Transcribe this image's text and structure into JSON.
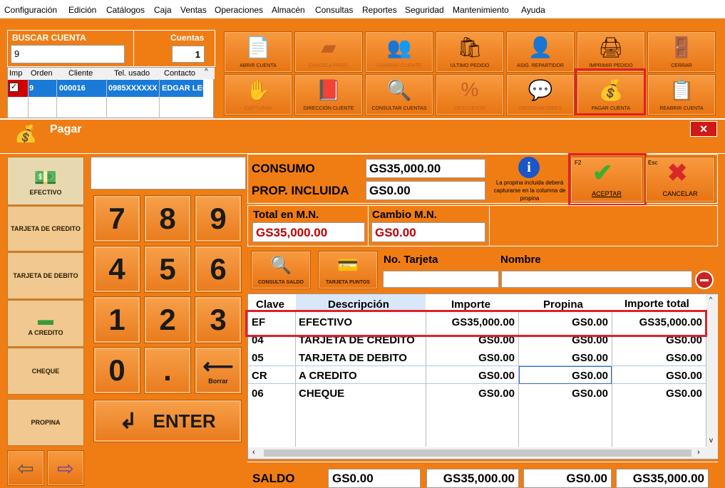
{
  "menu": [
    "Configuración",
    "Edición",
    "Catálogos",
    "Caja",
    "Ventas",
    "Operaciones",
    "Almacén",
    "Consultas",
    "Reportes",
    "Seguridad",
    "Mantenimiento",
    "Ayuda"
  ],
  "search": {
    "label": "BUSCAR CUENTA",
    "value": "9",
    "count_label": "Cuentas",
    "count_value": "1"
  },
  "accounts": {
    "headers": [
      "Imp",
      "Orden",
      "Cliente",
      "Tel. usado",
      "Contacto"
    ],
    "row": {
      "orden": "9",
      "cliente": "000016",
      "tel": "0985XXXXXX",
      "contacto": "EDGAR LEC"
    }
  },
  "toolbar": {
    "abrir": "ABRIR CUENTA",
    "cancela": "CANCELA PROD.",
    "cambiar": "CAMBIAR CLIENTE",
    "ultimo": "ULTIMO PEDIDO",
    "asig": "ASIG. REPARTIDOR",
    "imprimir": "IMPRIMIR PEDIDO",
    "cerrar": "CERRAR",
    "capturar": "CAPTURAR",
    "direccion": "DIRECCIÓN CLIENTE",
    "consultar": "CONSULTAR CUENTAS",
    "descuento": "DESCUENTO",
    "observ": "OBSERVACIONES",
    "pagar": "PAGAR CUENTA",
    "reabrir": "REABRIR CUENTA"
  },
  "dialog": {
    "title": "Pagar",
    "close": "×"
  },
  "methods": {
    "efectivo": "EFECTIVO",
    "tcredito": "TARJETA DE CREDITO",
    "tdebito": "TARJETA DE DEBITO",
    "acredito": "A CREDITO",
    "cheque": "CHEQUE",
    "propina": "PROPINA"
  },
  "keypad": {
    "k7": "7",
    "k8": "8",
    "k9": "9",
    "k4": "4",
    "k5": "5",
    "k6": "6",
    "k1": "1",
    "k2": "2",
    "k3": "3",
    "k0": "0",
    "kdot": ".",
    "borrar": "Borrar",
    "enter": "ENTER"
  },
  "summary": {
    "consumo_label": "CONSUMO",
    "consumo_value": "GS35,000.00",
    "prop_label": "PROP. INCLUIDA",
    "prop_value": "GS0.00",
    "info": "La propina incluida deberá capturarse en la columna de propina",
    "aceptar": "ACEPTAR",
    "aceptar_key": "F2",
    "cancelar": "CANCELAR",
    "cancelar_key": "Esc",
    "total_label": "Total en M.N.",
    "total_value": "GS35,000.00",
    "cambio_label": "Cambio M.N.",
    "cambio_value": "GS0.00"
  },
  "card": {
    "consulta_saldo": "CONSULTA SALDO",
    "tarjeta_puntos": "TARJETA PUNTOS",
    "no_tarjeta": "No. Tarjeta",
    "nombre": "Nombre"
  },
  "payments": {
    "headers": [
      "Clave",
      "Descripción",
      "Importe",
      "Propina",
      "Importe total"
    ],
    "rows": [
      [
        "EF",
        "EFECTIVO",
        "GS35,000.00",
        "GS0.00",
        "GS35,000.00"
      ],
      [
        "04",
        "TARJETA DE CREDITO",
        "GS0.00",
        "GS0.00",
        "GS0.00"
      ],
      [
        "05",
        "TARJETA DE DEBITO",
        "GS0.00",
        "GS0.00",
        "GS0.00"
      ],
      [
        "CR",
        "A CREDITO",
        "GS0.00",
        "GS0.00",
        "GS0.00"
      ],
      [
        "06",
        "CHEQUE",
        "GS0.00",
        "GS0.00",
        "GS0.00"
      ]
    ]
  },
  "footer": {
    "saldo_label": "SALDO",
    "saldo_value": "GS0.00",
    "importe": "GS35,000.00",
    "propina": "GS0.00",
    "total": "GS35,000.00"
  }
}
